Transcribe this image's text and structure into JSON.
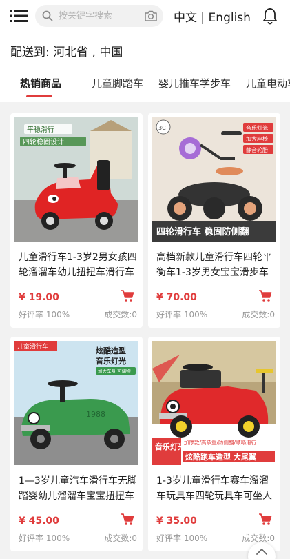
{
  "search": {
    "placeholder": "按关键字搜索"
  },
  "language": {
    "chinese": "中文",
    "separator": "|",
    "english": "English"
  },
  "shipping": {
    "label": "配送到:",
    "location": "河北省 , 中国"
  },
  "tabs": [
    {
      "label": "热销商品",
      "active": true
    },
    {
      "label": "儿童脚踏车"
    },
    {
      "label": "婴儿推车学步车"
    },
    {
      "label": "儿童电动车"
    }
  ],
  "products": [
    {
      "title": "儿童滑行车1-3岁2男女孩四轮溜溜车幼儿扭扭车滑行车",
      "price": "¥ 19.00",
      "rating": "好评率 100%",
      "sold": "成交数:0",
      "image_text": [
        "平稳滑行",
        "四轮稳固设计"
      ],
      "image_colors": {
        "bg": "#c8d6cf",
        "body": "#e02424"
      }
    },
    {
      "title": "高档新款儿童滑行车四轮平衡车1-3岁男女宝宝滑步车",
      "price": "¥ 70.00",
      "rating": "好评率 100%",
      "sold": "成交数:0",
      "image_text": [
        "四轮滑行车 稳固防侧翻",
        "音乐灯光",
        "加大座椅",
        "静音轮胎",
        "3C"
      ],
      "image_colors": {
        "bg": "#e9e1d8",
        "body": "#2f2f2f"
      }
    },
    {
      "title": "1—3岁儿童汽车滑行车无脚踏婴幼儿溜溜车宝宝扭扭车",
      "price": "¥ 45.00",
      "rating": "好评率 100%",
      "sold": "成交数:0",
      "image_text": [
        "儿童滑行车",
        "炫酷造型",
        "音乐灯光",
        "加大车身 可储物",
        "1988"
      ],
      "image_colors": {
        "bg": "#cfe6f2",
        "body": "#3a9a4e"
      }
    },
    {
      "title": "1-3岁儿童滑行车赛车溜溜车玩具车四轮玩具车可坐人",
      "price": "¥ 35.00",
      "rating": "好评率 100%",
      "sold": "成交数:0",
      "image_text": [
        "音乐灯光",
        "炫酷跑车造型 大尾翼",
        "加厚款/高承重/防侧翻/顺畅滑行"
      ],
      "image_colors": {
        "bg": "#d7c9a4",
        "body": "#e0292b"
      }
    }
  ],
  "colors": {
    "accent": "#e03c3c",
    "background": "#f2f2f2"
  },
  "icons": [
    "menu-icon",
    "search-icon",
    "camera-icon",
    "bell-icon",
    "cart-icon",
    "chevron-up-icon"
  ]
}
